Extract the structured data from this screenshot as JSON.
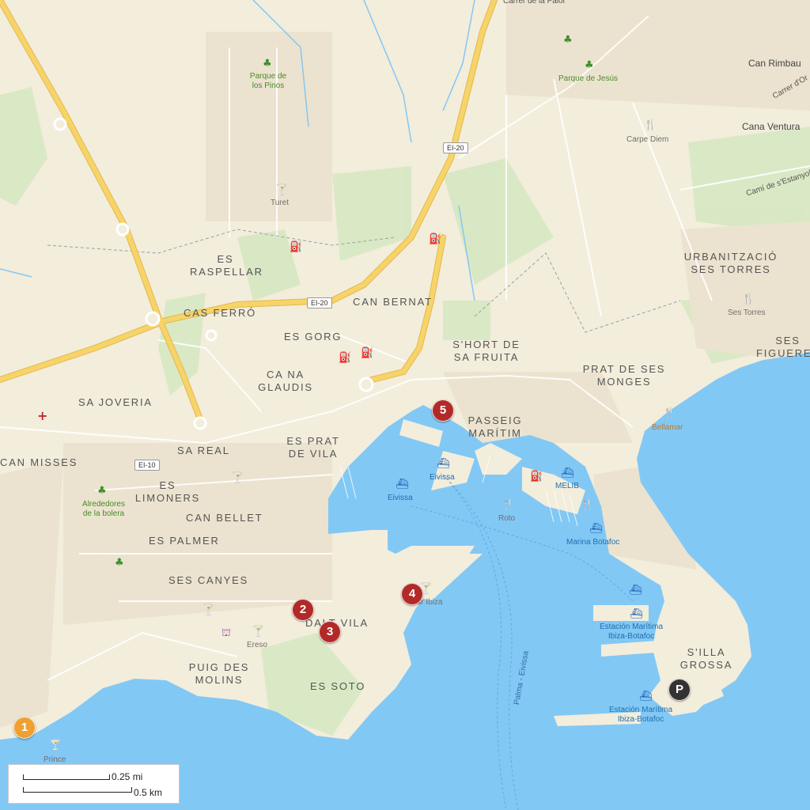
{
  "map": {
    "colors": {
      "land": "#f3eddc",
      "water": "#82c8f5",
      "green": "#d7e8c2",
      "motorway": "#f6d46a",
      "marker_red": "#b22a28",
      "marker_orange": "#eea033",
      "marker_dark": "#333333"
    },
    "districts": {
      "es_raspellar": "ES\nRASPELLAR",
      "cas_ferro": "CAS FERRÓ",
      "can_bernat": "CAN BERNAT",
      "es_gorg": "ES GORG",
      "ca_na_glaudis": "CA NA\nGLAUDIS",
      "sa_joveria": "SA JOVERIA",
      "can_misses": "CAN MISSES",
      "sa_real": "SA REAL",
      "es_limoners": "ES\nLIMONERS",
      "can_bellet": "CAN BELLET",
      "es_palmer": "ES PALMER",
      "ses_canyes": "SES CANYES",
      "puig_des_molins": "PUIG DES\nMOLINS",
      "dalt_vila": "DALT VILA",
      "es_soto": "ES SOTO",
      "es_prat_de_vila": "ES PRAT\nDE VILA",
      "shortdesafruita": "S'HORT DE\nSA FRUITA",
      "passeig_maritim": "PASSEIG\nMARÍTIM",
      "prat_de_ses_monges": "PRAT DE SES\nMONGES",
      "urbanitzacio": "URBANITZACIÓ\nSES TORRES",
      "ses_figueres": "SES\nFIGUERES",
      "silla_grossa": "S'ILLA\nGROSSA"
    },
    "places": {
      "can_rimbau": "Can Rimbau",
      "cana_ventura": "Cana Ventura"
    },
    "roads": {
      "carrer_top": "Carrer de la Palol",
      "carrer_right": "Carrer d'Or",
      "cami_estanyol": "Camí de s'Estanyol",
      "palma_eivissa": "Palma - Eivissa",
      "ei20_top": "EI-20",
      "ei20_mid": "EI-20",
      "ei10": "EI-10"
    },
    "parks": {
      "parque_pinos": "Parque de\nlos Pinos",
      "parque_jesus": "Parque de Jesús",
      "alrededores": "Alrededores\nde la bolera"
    },
    "pois": {
      "turet": "Turet",
      "carpe_diem": "Carpe Diem",
      "ses_torres": "Ses Torres",
      "bellamar": "Bellamar",
      "roto": "Roto",
      "ereso": "Ereso",
      "prince": "Prince",
      "bar_ibiza": "Bar Ibiza"
    },
    "ferry_terminals": {
      "eivissa_1": "Eivissa",
      "eivissa_2": "Eivissa",
      "melib": "MELIB",
      "marina_botafoc": "Marina Botafoc",
      "estacion_1": "Estación Marítima\nIbiza-Botafoc",
      "estacion_2": "Estación Marítima\nIbiza-Botafoc"
    },
    "markers": {
      "m1": "1",
      "m2": "2",
      "m3": "3",
      "m4": "4",
      "m5": "5",
      "parking": "P"
    },
    "scale": {
      "imperial": "0.25 mi",
      "metric": "0.5 km"
    },
    "icons": {
      "fuel": "fuel-icon",
      "ferry": "ferry-icon",
      "restaurant": "restaurant-icon",
      "bar": "bar-icon",
      "park": "park-tree-icon",
      "hospital": "hospital-icon",
      "museum": "museum-icon"
    }
  }
}
